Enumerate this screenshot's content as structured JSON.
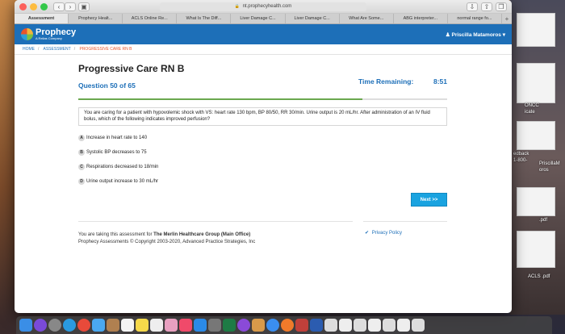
{
  "browser": {
    "url": "nt.prophecyhealth.com",
    "tabs": [
      "Assessment",
      "Prophecy Healt...",
      "ACLS Online Re...",
      "What Is The Diff...",
      "Liver Damage C...",
      "Liver Damage C...",
      "What Are Some...",
      "ABG interpreter...",
      "normal range fo..."
    ]
  },
  "app": {
    "logo_name": "Prophecy",
    "logo_sub": "A Relias Company",
    "user_name": "Priscilla Matamoros"
  },
  "breadcrumb": {
    "home": "HOME",
    "assessment": "ASSESSMENT",
    "current": "PROGRESSIVE CARE RN B"
  },
  "assessment": {
    "title": "Progressive Care RN B",
    "question_counter": "Question 50 of 65",
    "time_label": "Time Remaining:",
    "time_value": "8:51",
    "progress_fraction": 0.77,
    "question_text": "You are caring for a patient with hypovolemic shock with VS: heart rate 130 bpm, BP 80/50, RR 30/min. Urine output is 20 mL/hr. After administration of an IV fluid bolus, which of the following indicates improved perfusion?",
    "options": [
      {
        "letter": "A",
        "text": "Increase in heart rate to 140"
      },
      {
        "letter": "B",
        "text": "Systolic BP decreases to 75"
      },
      {
        "letter": "C",
        "text": "Respirations decreased to 18/min"
      },
      {
        "letter": "D",
        "text": "Urine output increase to 30 mL/hr"
      }
    ],
    "next_label": "Next >>"
  },
  "footer": {
    "taking_prefix": "You are taking this assessment for",
    "org": "The Merlin Healthcare Group (Main Office)",
    "copyright": "Prophecy Assessments © Copyright 2003-2020, Advanced Practice Strategies, Inc",
    "privacy": "Privacy Policy"
  },
  "desktop": {
    "labels": [
      "ONCC",
      "icate",
      "edback",
      "1-800-",
      "PriscillaM",
      "oros",
      ".pdf",
      "ACLS .pdf"
    ]
  },
  "colors": {
    "brand": "#1d6fb8",
    "accent": "#e8542a",
    "button": "#1aa3e0",
    "progress": "#6aa84f"
  }
}
